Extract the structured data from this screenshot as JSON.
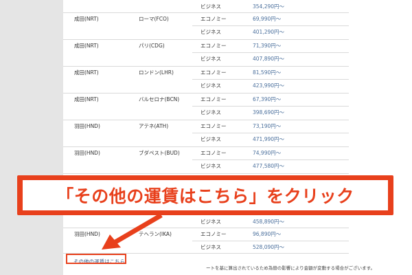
{
  "fares": [
    {
      "origin": "",
      "destination": "",
      "classes": [
        {
          "class": "ビジネス",
          "price": "354,290円〜"
        }
      ]
    },
    {
      "origin": "成田(NRT)",
      "destination": "ローマ(FCO)",
      "classes": [
        {
          "class": "エコノミー",
          "price": "69,990円〜"
        },
        {
          "class": "ビジネス",
          "price": "401,290円〜"
        }
      ]
    },
    {
      "origin": "成田(NRT)",
      "destination": "パリ(CDG)",
      "classes": [
        {
          "class": "エコノミー",
          "price": "71,390円〜"
        },
        {
          "class": "ビジネス",
          "price": "407,890円〜"
        }
      ]
    },
    {
      "origin": "成田(NRT)",
      "destination": "ロンドン(LHR)",
      "classes": [
        {
          "class": "エコノミー",
          "price": "81,590円〜"
        },
        {
          "class": "ビジネス",
          "price": "423,990円〜"
        }
      ]
    },
    {
      "origin": "成田(NRT)",
      "destination": "バルセロナ(BCN)",
      "classes": [
        {
          "class": "エコノミー",
          "price": "67,390円〜"
        },
        {
          "class": "ビジネス",
          "price": "398,690円〜"
        }
      ]
    },
    {
      "origin": "羽田(HND)",
      "destination": "アテネ(ATH)",
      "classes": [
        {
          "class": "エコノミー",
          "price": "73,190円〜"
        },
        {
          "class": "ビジネス",
          "price": "471,990円〜"
        }
      ]
    },
    {
      "origin": "羽田(HND)",
      "destination": "ブダペスト(BUD)",
      "classes": [
        {
          "class": "エコノミー",
          "price": "74,990円〜"
        },
        {
          "class": "ビジネス",
          "price": "477,580円〜"
        }
      ]
    },
    {
      "origin": "",
      "destination": "",
      "classes": [
        {
          "class": "ビジネス",
          "price": "458,890円〜"
        }
      ]
    },
    {
      "origin": "羽田(HND)",
      "destination": "テヘラン(IKA)",
      "classes": [
        {
          "class": "エコノミー",
          "price": "96,890円〜"
        },
        {
          "class": "ビジネス",
          "price": "528,090円〜"
        }
      ]
    }
  ],
  "more_fares_link": "その他の運賃はこちら",
  "footnote": "ートを基に算出されているため為替の影響により金額が変動する場合がございます。",
  "callout_text": "「その他の運賃はこちら」をクリック",
  "colors": {
    "accent": "#e8401c",
    "link": "#3a5e8c"
  }
}
